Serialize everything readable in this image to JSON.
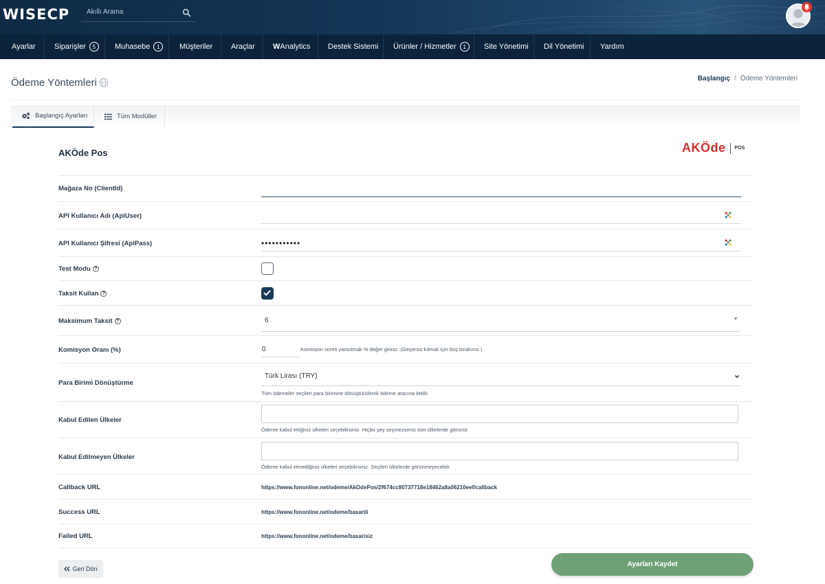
{
  "header": {
    "logo": "WISECP",
    "search_placeholder": "Akıllı Arama"
  },
  "nav": {
    "items": [
      {
        "label": "Ayarlar"
      },
      {
        "label": "Siparişler",
        "badge": "5"
      },
      {
        "label": "Muhasebe",
        "badge": "1"
      },
      {
        "label": "Müşteriler"
      },
      {
        "label": "Araçlar"
      },
      {
        "label_prefix": "W",
        "label": "Analytics"
      },
      {
        "label": "Destek Sistemi"
      },
      {
        "label": "Ürünler / Hizmetler",
        "badge": "1"
      },
      {
        "label": "Site Yönetimi"
      },
      {
        "label": "Dil Yönetimi"
      },
      {
        "label": "Yardım"
      }
    ]
  },
  "page": {
    "title": "Ödeme Yöntemleri",
    "breadcrumb": {
      "home": "Başlangıç",
      "separator": "/",
      "current": "Ödeme Yöntemleri"
    }
  },
  "tabs": [
    {
      "label": "Başlangıç Ayarları",
      "active": true
    },
    {
      "label": "Tüm Modüller",
      "active": false
    }
  ],
  "module": {
    "title": "AKÖde Pos",
    "logo_main": "AKÖde",
    "logo_sub": "POS"
  },
  "form": {
    "client_id": {
      "label": "Mağaza No (ClientId)",
      "value": ""
    },
    "api_user": {
      "label": "API Kullanıcı Adı (ApiUser)",
      "value": ""
    },
    "api_pass": {
      "label": "API Kullanıcı Şifresi (ApiPass)",
      "value": "•••••••••••"
    },
    "test_mode": {
      "label": "Test Modu",
      "checked": false
    },
    "installment": {
      "label": "Taksit Kullan",
      "checked": true
    },
    "max_installment": {
      "label": "Maksimum Taksit",
      "value": "6"
    },
    "commission": {
      "label": "Komisyon Oranı (%)",
      "value": "0",
      "hint": "Komisyon ücreti yansıtmak % değer giriniz. (Geçersiz kılmak için boş bırakınız.)"
    },
    "currency": {
      "label": "Para Birimi Dönüştürme",
      "value": "Türk Lirası (TRY)",
      "hint": "Tüm ödemeler seçilen para birimine dönüştürülerek ödeme aracına iletilir."
    },
    "allowed_countries": {
      "label": "Kabul Edilen Ülkeler",
      "hint": "Ödeme kabul ettiğiniz ülkeleri seçebilirsiniz. Hiçbir şey seçmezseniz tüm ülkelerde görünür."
    },
    "blocked_countries": {
      "label": "Kabul Edilmeyen Ülkeler",
      "hint": "Ödeme kabul etmediğiniz ülkeleri seçebilirsiniz. Seçilen ülkelerde görünmeyecektir."
    },
    "callback_url": {
      "label": "Callback URL",
      "value": "https://www.fononline.net/odeme/AkOdePos/2f674cc80737718e18462a8a06210eef/callback"
    },
    "success_url": {
      "label": "Success URL",
      "value": "https://www.fononline.net/odeme/basarili"
    },
    "failed_url": {
      "label": "Failed URL",
      "value": "https://www.fononline.net/odeme/basarisiz"
    }
  },
  "buttons": {
    "back": "Geri Dön",
    "save": "Ayarları Kaydet"
  },
  "colors": {
    "header_bg": "#0e2a45",
    "nav_bg": "#0b243c",
    "save_button": "#6fa177",
    "brand_red": "#d32f2f"
  }
}
